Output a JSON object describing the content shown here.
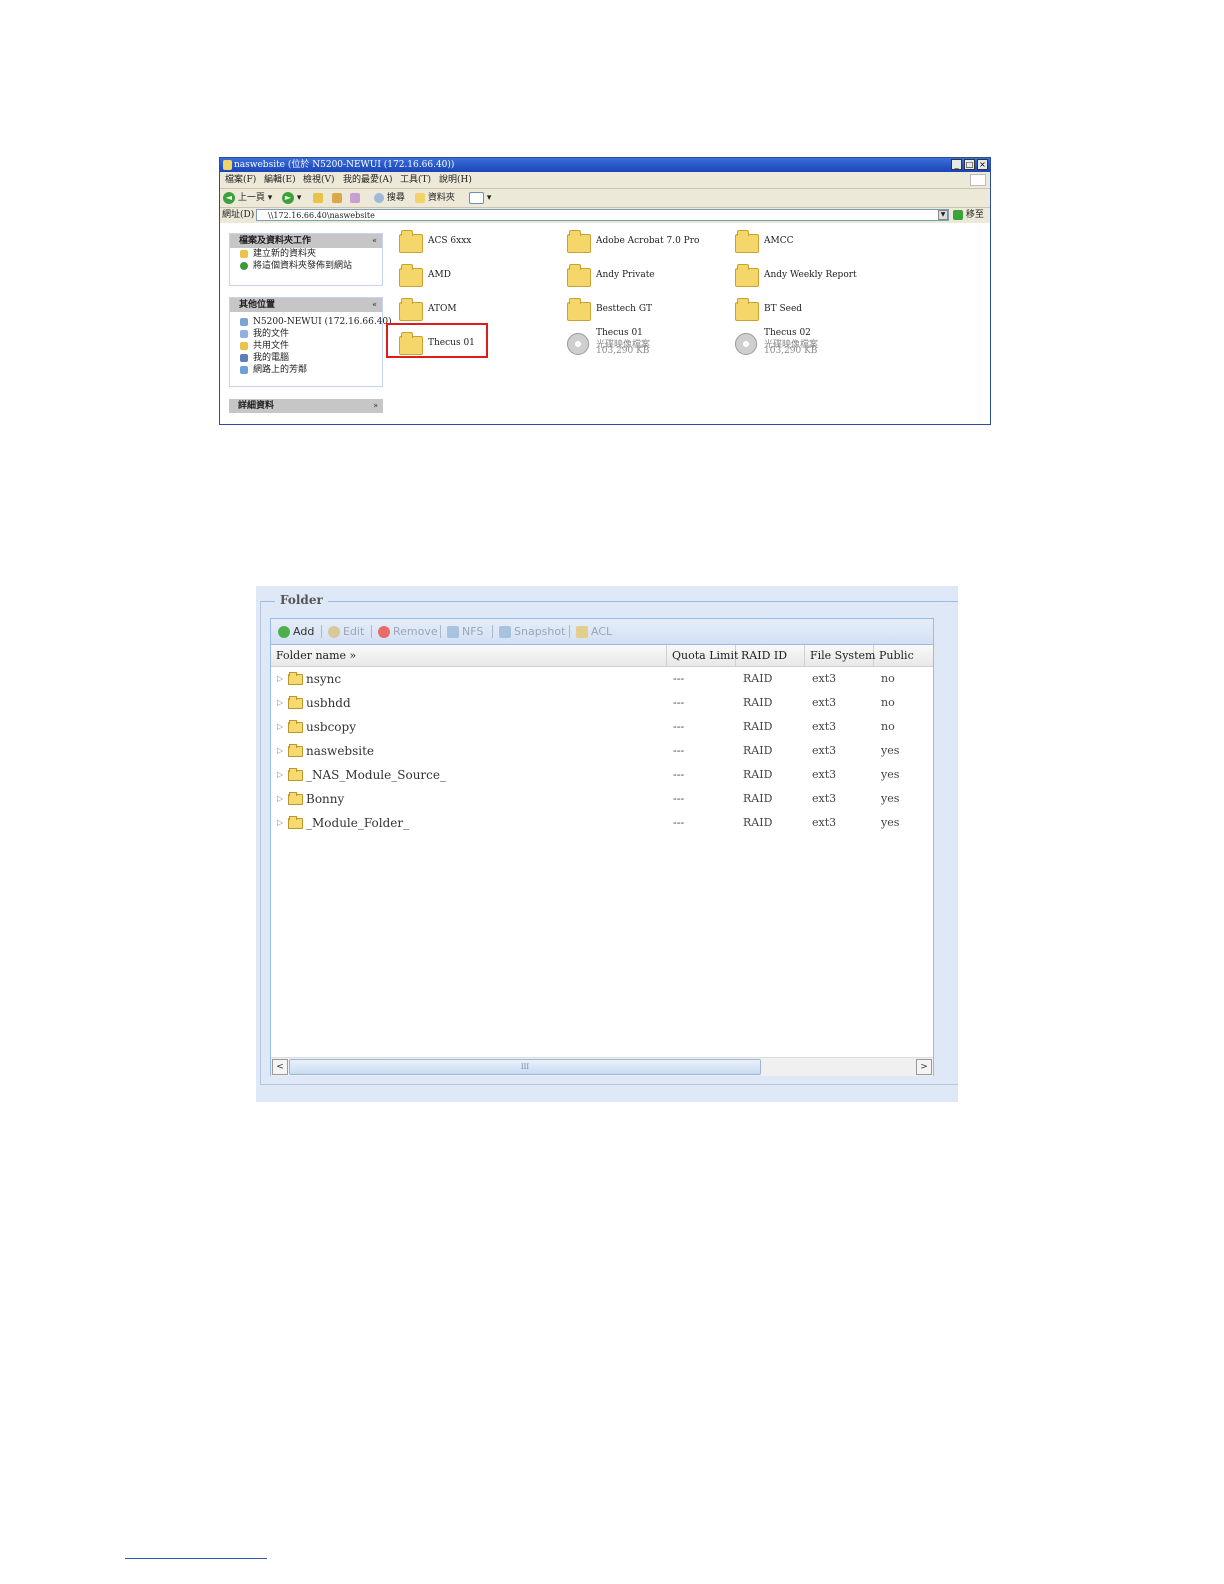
{
  "explorer": {
    "title": "naswebsite (位於 N5200-NEWUI (172.16.66.40))",
    "menu": [
      "檔案(F)",
      "編輯(E)",
      "檢視(V)",
      "我的最愛(A)",
      "工具(T)",
      "說明(H)"
    ],
    "toolbar": {
      "back": "上一頁",
      "search": "搜尋",
      "folders": "資料夾"
    },
    "address_label": "網址(D)",
    "address": "\\\\172.16.66.40\\naswebsite",
    "go_label": "移至",
    "tasks": {
      "header": "檔案及資料夾工作",
      "items": [
        "建立新的資料夾",
        "將這個資料夾發佈到網站"
      ]
    },
    "other_places": {
      "header": "其他位置",
      "items": [
        "N5200-NEWUI (172.16.66.40)",
        "我的文件",
        "共用文件",
        "我的電腦",
        "網路上的芳鄰"
      ]
    },
    "details": {
      "header": "詳細資料"
    },
    "files": [
      {
        "name": "ACS 6xxx",
        "kind": "folder"
      },
      {
        "name": "Adobe Acrobat 7.0 Pro",
        "kind": "folder"
      },
      {
        "name": "AMCC",
        "kind": "folder"
      },
      {
        "name": "AMD",
        "kind": "folder"
      },
      {
        "name": "Andy Private",
        "kind": "folder"
      },
      {
        "name": "Andy Weekly Report",
        "kind": "folder"
      },
      {
        "name": "ATOM",
        "kind": "folder"
      },
      {
        "name": "Besttech GT",
        "kind": "folder"
      },
      {
        "name": "BT Seed",
        "kind": "folder"
      },
      {
        "name": "Thecus 01",
        "kind": "folder",
        "highlighted": true
      },
      {
        "name": "Thecus 01",
        "kind": "disc",
        "type": "光碟映像檔案",
        "size": "103,290 KB"
      },
      {
        "name": "Thecus 02",
        "kind": "disc",
        "type": "光碟映像檔案",
        "size": "103,290 KB"
      }
    ]
  },
  "folder_panel": {
    "legend": "Folder",
    "toolbar": [
      {
        "label": "Add",
        "enabled": true,
        "icon": "add-icon"
      },
      {
        "label": "Edit",
        "enabled": false,
        "icon": "edit-icon"
      },
      {
        "label": "Remove",
        "enabled": false,
        "icon": "remove-icon"
      },
      {
        "label": "NFS",
        "enabled": false,
        "icon": "nfs-icon"
      },
      {
        "label": "Snapshot",
        "enabled": false,
        "icon": "snapshot-icon"
      },
      {
        "label": "ACL",
        "enabled": false,
        "icon": "acl-icon"
      }
    ],
    "columns": [
      "Folder name »",
      "Quota Limit",
      "RAID ID",
      "File System",
      "Public"
    ],
    "rows": [
      {
        "name": "nsync",
        "quota": "---",
        "raid": "RAID",
        "fs": "ext3",
        "public": "no"
      },
      {
        "name": "usbhdd",
        "quota": "---",
        "raid": "RAID",
        "fs": "ext3",
        "public": "no"
      },
      {
        "name": "usbcopy",
        "quota": "---",
        "raid": "RAID",
        "fs": "ext3",
        "public": "no"
      },
      {
        "name": "naswebsite",
        "quota": "---",
        "raid": "RAID",
        "fs": "ext3",
        "public": "yes"
      },
      {
        "name": "_NAS_Module_Source_",
        "quota": "---",
        "raid": "RAID",
        "fs": "ext3",
        "public": "yes"
      },
      {
        "name": "Bonny",
        "quota": "---",
        "raid": "RAID",
        "fs": "ext3",
        "public": "yes"
      },
      {
        "name": "_Module_Folder_",
        "quota": "---",
        "raid": "RAID",
        "fs": "ext3",
        "public": "yes"
      }
    ],
    "scroll_thumb": "III"
  }
}
